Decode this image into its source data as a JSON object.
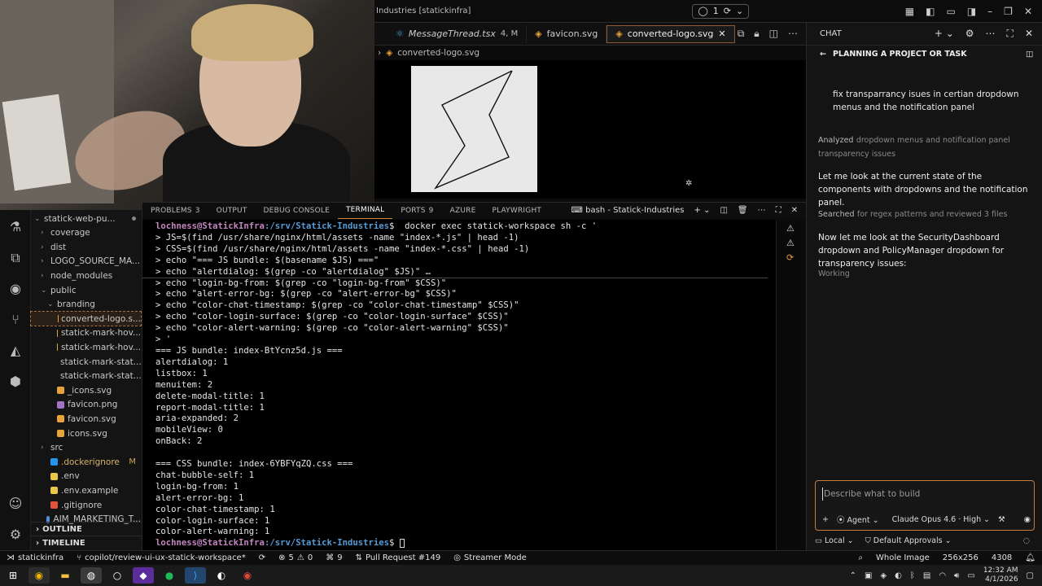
{
  "window": {
    "title": "Industries [statickinfra]",
    "pill_count": "1"
  },
  "explorer": {
    "items": [
      {
        "label": "statick-web-pu...",
        "depth": 1,
        "kind": "folder-open"
      },
      {
        "label": "coverage",
        "depth": 2,
        "kind": "folder"
      },
      {
        "label": "dist",
        "depth": 2,
        "kind": "folder"
      },
      {
        "label": "LOGO_SOURCE_MA...",
        "depth": 2,
        "kind": "folder"
      },
      {
        "label": "node_modules",
        "depth": 2,
        "kind": "folder"
      },
      {
        "label": "public",
        "depth": 2,
        "kind": "folder-open"
      },
      {
        "label": "branding",
        "depth": 3,
        "kind": "folder-open"
      },
      {
        "label": "converted-logo.s...",
        "depth": 4,
        "kind": "svg",
        "selected": true
      },
      {
        "label": "statick-mark-hov...",
        "depth": 4,
        "kind": "svg"
      },
      {
        "label": "statick-mark-hov...",
        "depth": 4,
        "kind": "svg"
      },
      {
        "label": "statick-mark-stat...",
        "depth": 4,
        "kind": "svg"
      },
      {
        "label": "statick-mark-stat...",
        "depth": 4,
        "kind": "svg"
      },
      {
        "label": "_icons.svg",
        "depth": 3,
        "kind": "svg"
      },
      {
        "label": "favicon.png",
        "depth": 3,
        "kind": "png"
      },
      {
        "label": "favicon.svg",
        "depth": 3,
        "kind": "svg"
      },
      {
        "label": "icons.svg",
        "depth": 3,
        "kind": "svg"
      },
      {
        "label": "src",
        "depth": 2,
        "kind": "folder"
      },
      {
        "label": ".dockerignore",
        "depth": 2,
        "kind": "docker",
        "badge": "M"
      },
      {
        "label": ".env",
        "depth": 2,
        "kind": "env"
      },
      {
        "label": ".env.example",
        "depth": 2,
        "kind": "env"
      },
      {
        "label": ".gitignore",
        "depth": 2,
        "kind": "git"
      },
      {
        "label": "AIM_MARKETING_T...",
        "depth": 2,
        "kind": "md"
      }
    ],
    "outline_label": "OUTLINE",
    "timeline_label": "TIMELINE"
  },
  "editor": {
    "tabs": [
      {
        "label": "MessageThread.tsx",
        "mod": "4, M",
        "italic": true
      },
      {
        "label": "favicon.svg",
        "mod": ""
      },
      {
        "label": "converted-logo.svg",
        "mod": "",
        "active": true
      }
    ],
    "breadcrumb": "converted-logo.svg"
  },
  "panel": {
    "tabs": [
      {
        "label": "PROBLEMS",
        "count": "3"
      },
      {
        "label": "OUTPUT",
        "count": ""
      },
      {
        "label": "DEBUG CONSOLE",
        "count": ""
      },
      {
        "label": "TERMINAL",
        "count": "",
        "active": true
      },
      {
        "label": "PORTS",
        "count": "9"
      },
      {
        "label": "AZURE",
        "count": ""
      },
      {
        "label": "PLAYWRIGHT",
        "count": ""
      }
    ],
    "terminal_name": "bash - Statick-Industries"
  },
  "terminal": {
    "prompt_user": "lochness@StatickInfra",
    "prompt_path": ":/srv/Statick-Industries",
    "command": "$  docker exec statick-workspace sh -c '",
    "lines": [
      "> JS=$(find /usr/share/nginx/html/assets -name \"index-*.js\" | head -1)",
      "> CSS=$(find /usr/share/nginx/html/assets -name \"index-*.css\" | head -1)",
      "> echo \"=== JS bundle: $(basename $JS) ===\"",
      "> echo \"alertdialog: $(grep -co \"alertdialog\" $JS)\" …",
      "> echo \"login-bg-from: $(grep -co \"login-bg-from\" $CSS)\"",
      "> echo \"alert-error-bg: $(grep -co \"alert-error-bg\" $CSS)\"",
      "> echo \"color-chat-timestamp: $(grep -co \"color-chat-timestamp\" $CSS)\"",
      "> echo \"color-login-surface: $(grep -co \"color-login-surface\" $CSS)\"",
      "> echo \"color-alert-warning: $(grep -co \"color-alert-warning\" $CSS)\"",
      "> '",
      "=== JS bundle: index-BtYcnz5d.js ===",
      "alertdialog: 1",
      "listbox: 1",
      "menuitem: 2",
      "delete-modal-title: 1",
      "report-modal-title: 1",
      "aria-expanded: 2",
      "mobileView: 0",
      "onBack: 2",
      "",
      "=== CSS bundle: index-6YBFYqZQ.css ===",
      "chat-bubble-self: 1",
      "login-bg-from: 1",
      "alert-error-bg: 1",
      "color-chat-timestamp: 1",
      "color-login-surface: 1",
      "color-alert-warning: 1"
    ],
    "final_prompt_tail": "$ "
  },
  "chat": {
    "header": "CHAT",
    "subheader": "PLANNING A PROJECT OR TASK",
    "user_message": "fix transparrancy isues in certian dropdown menus and the notification panel",
    "analyzed_label": "Analyzed",
    "analyzed_text": "dropdown menus and notification panel transparency issues",
    "msg1": "Let me look at the current state of the components with dropdowns and the notification panel.",
    "searched_label": "Searched",
    "searched_text": "for regex patterns and reviewed 3 files",
    "msg2": "Now let me look at the SecurityDashboard dropdown and PolicyManager dropdown for transparency issues:",
    "working": "Working",
    "input_placeholder": "Describe what to build",
    "agent_label": "Agent",
    "model_label": "Claude Opus 4.6 · High",
    "local_label": "Local",
    "approvals_label": "Default Approvals"
  },
  "statusbar": {
    "remote": "statickinfra",
    "branch": "copilot/review-ui-ux-statick-workspace*",
    "errors": "5",
    "warnings": "0",
    "info": "9",
    "pr": "Pull Request #149",
    "streamer": "Streamer Mode",
    "whole_image": "Whole Image",
    "dims": "256x256",
    "size": "4308"
  },
  "taskbar": {
    "time": "12:32 AM",
    "date": "4/1/2026"
  },
  "colors": {
    "accent": "#c77a3a",
    "prompt": "#c586c0",
    "path": "#569cd6"
  }
}
